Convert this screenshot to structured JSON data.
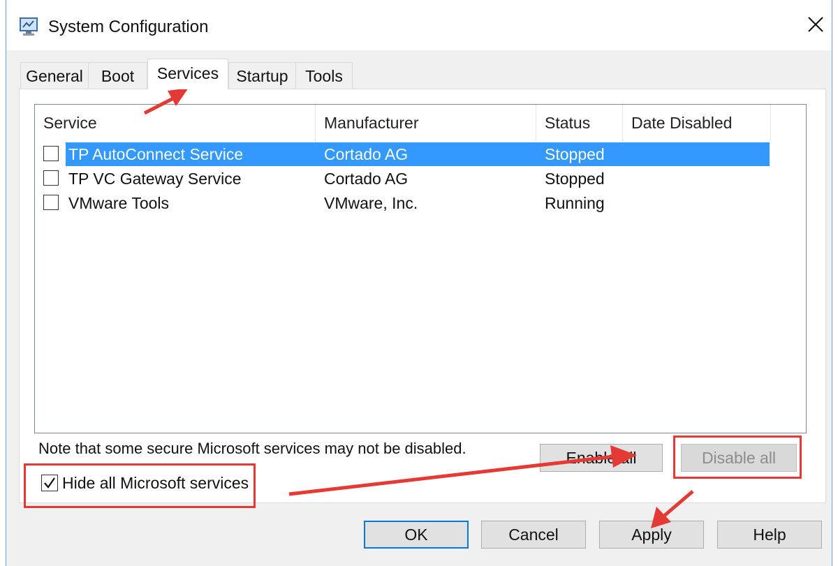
{
  "window": {
    "title": "System Configuration",
    "app_icon": "msconfig-icon",
    "close_icon": "close-icon"
  },
  "tabs": [
    {
      "label": "General",
      "active": false
    },
    {
      "label": "Boot",
      "active": false
    },
    {
      "label": "Services",
      "active": true
    },
    {
      "label": "Startup",
      "active": false
    },
    {
      "label": "Tools",
      "active": false
    }
  ],
  "services_table": {
    "columns": [
      "Service",
      "Manufacturer",
      "Status",
      "Date Disabled"
    ],
    "rows": [
      {
        "service": "TP AutoConnect Service",
        "manufacturer": "Cortado AG",
        "status": "Stopped",
        "date_disabled": "",
        "checked": false,
        "selected": true
      },
      {
        "service": "TP VC Gateway Service",
        "manufacturer": "Cortado AG",
        "status": "Stopped",
        "date_disabled": "",
        "checked": false,
        "selected": false
      },
      {
        "service": "VMware Tools",
        "manufacturer": "VMware, Inc.",
        "status": "Running",
        "date_disabled": "",
        "checked": false,
        "selected": false
      }
    ]
  },
  "note": "Note that some secure Microsoft services may not be disabled.",
  "buttons": {
    "enable_all": "Enable all",
    "disable_all": "Disable all",
    "ok": "OK",
    "cancel": "Cancel",
    "apply": "Apply",
    "help": "Help"
  },
  "hide_microsoft": {
    "label": "Hide all Microsoft services",
    "checked": true
  },
  "colors": {
    "selection": "#3399ff",
    "annotation": "#e53935",
    "default_button_border": "#0078d7"
  }
}
